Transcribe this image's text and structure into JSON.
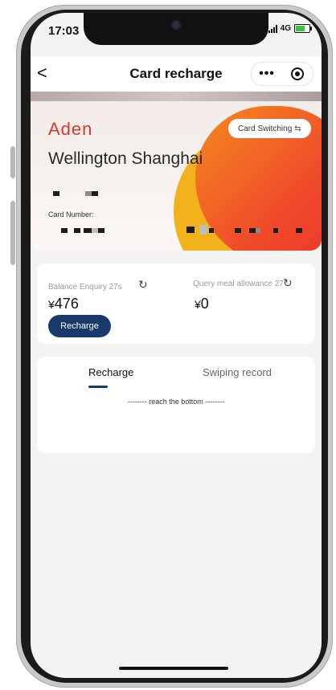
{
  "status_bar": {
    "time": "17:03",
    "network": "4G"
  },
  "navbar": {
    "back": "<",
    "title": "Card recharge",
    "more": "•••"
  },
  "card": {
    "brand": "Aden",
    "venue": "Wellington Shanghai",
    "switch_label": "Card Switching",
    "card_number_label": "Card Number:"
  },
  "balance": {
    "enquiry_label": "Balance Enquiry 27s",
    "currency": "¥",
    "amount": "476",
    "meal_label": "Query meal allowance 27",
    "meal_amount": "0",
    "recharge_button": "Recharge"
  },
  "tabs": {
    "items": [
      "Recharge",
      "Swiping record"
    ],
    "active_index": 0,
    "bottom_note": "-------- reach the bottom --------"
  },
  "colors": {
    "accent": "#183a6b",
    "brand": "#d63a2a",
    "card_orange": "#ef4a2a",
    "card_yellow": "#f2b21b"
  },
  "icons": [
    "back-chevron-icon",
    "more-dots-icon",
    "target-icon",
    "swap-arrows-icon",
    "refresh-icon",
    "signal-icon",
    "battery-icon"
  ]
}
